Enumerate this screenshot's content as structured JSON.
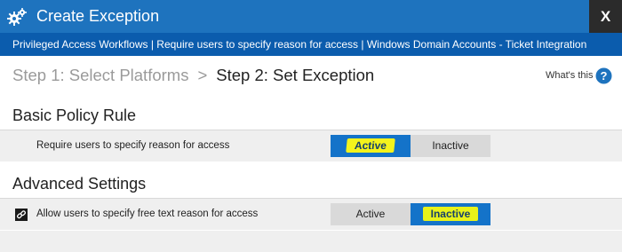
{
  "window": {
    "title": "Create Exception",
    "close_label": "X"
  },
  "breadcrumb": "Privileged Access Workflows | Require users to specify reason for access | Windows Domain Accounts - Ticket Integration",
  "steps": {
    "step1": "Step 1: Select Platforms",
    "separator": ">",
    "step2": "Step 2: Set Exception"
  },
  "help": {
    "label": "What's this"
  },
  "basic_policy": {
    "title": "Basic Policy Rule",
    "rule_label": "Require users to specify reason for access",
    "active_label": "Active",
    "inactive_label": "Inactive",
    "selected": "Active"
  },
  "advanced_settings": {
    "title": "Advanced Settings",
    "rule_label": "Allow users to specify free text reason for access",
    "active_label": "Active",
    "inactive_label": "Inactive",
    "selected": "Inactive"
  },
  "colors": {
    "title_bar": "#1e73be",
    "breadcrumb_bar": "#0b5cad",
    "selected_toggle": "#1473c9",
    "highlight": "#e8f21a",
    "unselected_toggle": "#d9d9d9"
  }
}
